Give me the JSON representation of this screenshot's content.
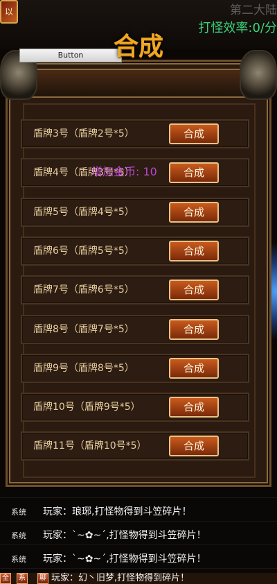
{
  "hud": {
    "icon_glyph": "以",
    "map_name": "第二大陆",
    "efficiency": "打怪效率:0/分"
  },
  "debug_button": {
    "label": "Button"
  },
  "panel": {
    "title": "合成",
    "float_message": "增加金币: 10",
    "recipes": [
      {
        "label": "盾牌3号（盾牌2号*5）",
        "button": "合成"
      },
      {
        "label": "盾牌4号（盾牌3号*5）",
        "button": "合成"
      },
      {
        "label": "盾牌5号（盾牌4号*5）",
        "button": "合成"
      },
      {
        "label": "盾牌6号（盾牌5号*5）",
        "button": "合成"
      },
      {
        "label": "盾牌7号（盾牌6号*5）",
        "button": "合成"
      },
      {
        "label": "盾牌8号（盾牌7号*5）",
        "button": "合成"
      },
      {
        "label": "盾牌9号（盾牌8号*5）",
        "button": "合成"
      },
      {
        "label": "盾牌10号（盾牌9号*5）",
        "button": "合成"
      },
      {
        "label": "盾牌11号（盾牌10号*5）",
        "button": "合成"
      }
    ]
  },
  "chat": {
    "lines": [
      {
        "channel": "系统",
        "message": "玩家：琅琊,打怪物得到斗笠碎片！"
      },
      {
        "channel": "系统",
        "message": "玩家：`~✿~´,打怪物得到斗笠碎片！"
      },
      {
        "channel": "系统",
        "message": "玩家：`~✿~´,打怪物得到斗笠碎片！"
      }
    ],
    "partial_line": "玩家：幻丶旧梦,打怪物得到碎片！"
  },
  "bottom_tabs": [
    "全",
    "系",
    "聊"
  ]
}
